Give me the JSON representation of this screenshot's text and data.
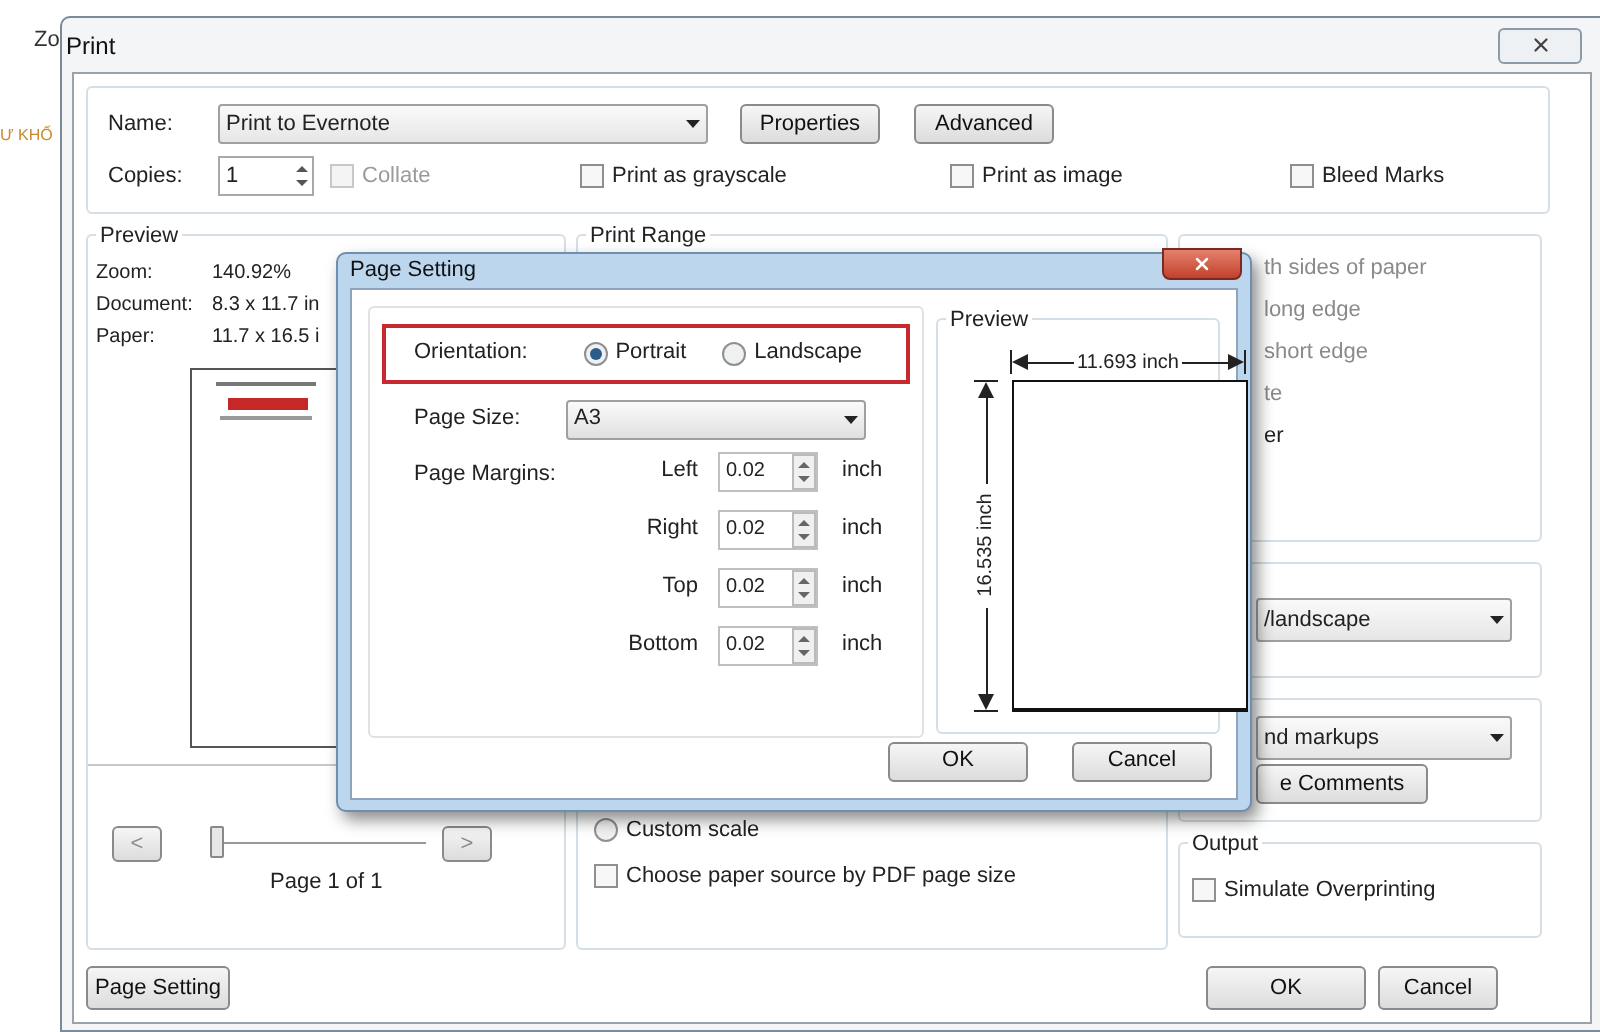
{
  "background": {
    "toolbar_fragment": "Zo",
    "side_fragment": "Ư KHỐ"
  },
  "print": {
    "title": "Print",
    "name_label": "Name:",
    "printer": "Print to Evernote",
    "properties": "Properties",
    "advanced": "Advanced",
    "copies_label": "Copies:",
    "copies": "1",
    "options": [
      {
        "label": "Collate",
        "checked": false,
        "disabled": true
      },
      {
        "label": "Print as grayscale",
        "checked": false,
        "disabled": false
      },
      {
        "label": "Print as image",
        "checked": false,
        "disabled": false
      },
      {
        "label": "Bleed Marks",
        "checked": false,
        "disabled": false
      }
    ],
    "preview": {
      "legend": "Preview",
      "rows": [
        {
          "label": "Zoom:",
          "value": "140.92%"
        },
        {
          "label": "Document:",
          "value": "8.3 x 11.7 in"
        },
        {
          "label": "Paper:",
          "value": "11.7 x 16.5 i"
        }
      ],
      "prev": "<",
      "next": ">",
      "level": 0,
      "page_label": "Page 1 of 1"
    },
    "print_range": {
      "legend": "Print Range",
      "custom_scale": {
        "label": "Custom scale",
        "selected": false
      },
      "paper_source": {
        "label": "Choose paper source by PDF page size",
        "checked": false
      }
    },
    "duplex_fragments": [
      {
        "text": "th sides of paper",
        "disabled": true
      },
      {
        "text": "long edge",
        "disabled": true
      },
      {
        "text": "short edge",
        "disabled": true
      },
      {
        "text": "te",
        "disabled": true
      },
      {
        "text": "er",
        "disabled": false
      }
    ],
    "orientation_dropdown": "/landscape",
    "comments_dropdown": "nd markups",
    "comments_button": "e Comments",
    "output": {
      "legend": "Output",
      "simulate": {
        "label": "Simulate Overprinting",
        "checked": false
      }
    },
    "page_setting_button": "Page Setting",
    "ok": "OK",
    "cancel": "Cancel"
  },
  "page_setting": {
    "title": "Page Setting",
    "orientation_label": "Orientation:",
    "orientations": [
      {
        "label": "Portrait",
        "selected": true
      },
      {
        "label": "Landscape",
        "selected": false
      }
    ],
    "page_size_label": "Page Size:",
    "page_size": "A3",
    "margins_label": "Page Margins:",
    "margins": [
      {
        "label": "Left",
        "value": "0.02",
        "unit": "inch"
      },
      {
        "label": "Right",
        "value": "0.02",
        "unit": "inch"
      },
      {
        "label": "Top",
        "value": "0.02",
        "unit": "inch"
      },
      {
        "label": "Bottom",
        "value": "0.02",
        "unit": "inch"
      }
    ],
    "preview_legend": "Preview",
    "width_label": "11.693 inch",
    "height_label": "16.535 inch",
    "ok": "OK",
    "cancel": "Cancel"
  }
}
